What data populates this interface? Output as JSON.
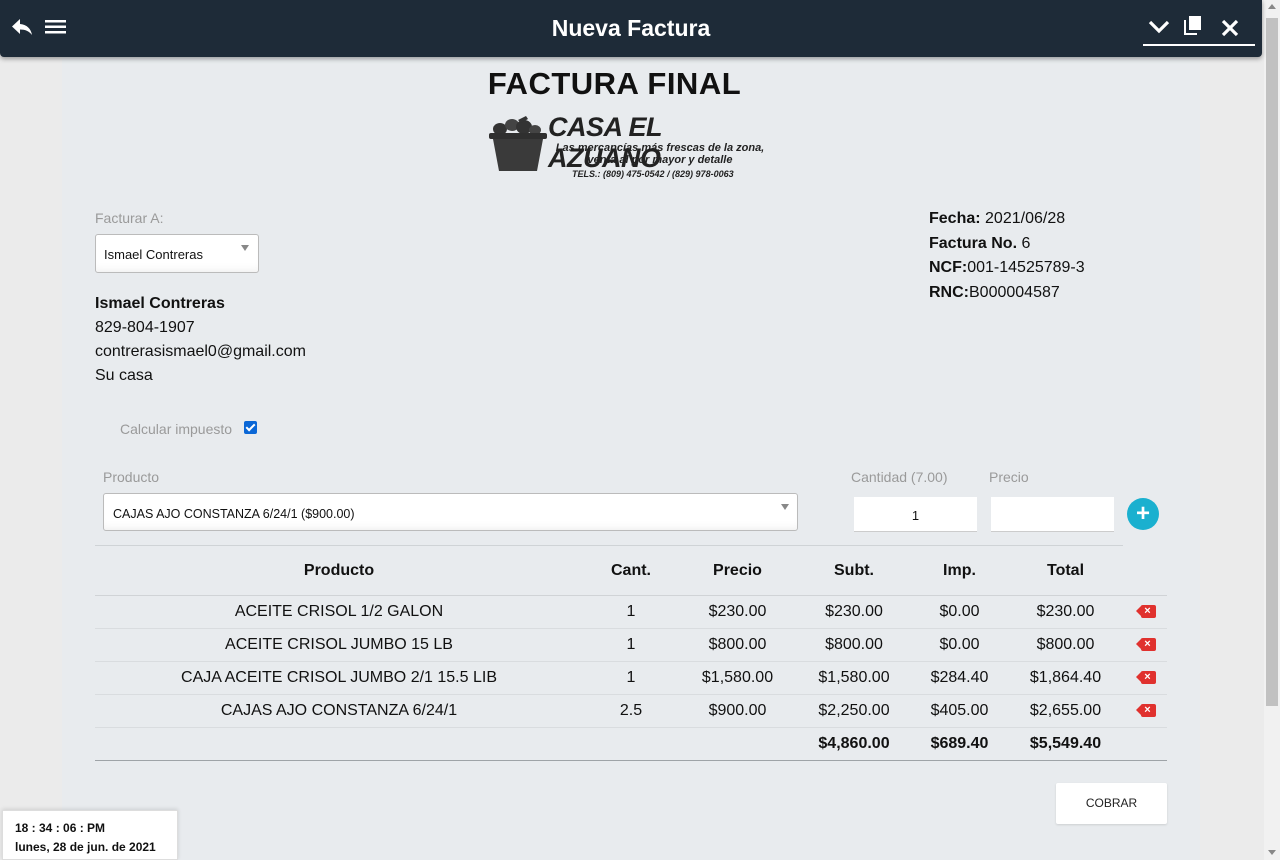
{
  "window": {
    "title": "Nueva Factura"
  },
  "icons": {
    "back": "back-arrow-icon",
    "menu": "menu-icon",
    "chevron": "chevron-down-icon",
    "copy": "copy-icon",
    "close": "close-icon",
    "add": "plus-icon",
    "delete": "delete-icon"
  },
  "invoice": {
    "heading": "FACTURA FINAL",
    "logo": {
      "brand": "CASA EL AZUANO",
      "tagline_1": "Las mercancías más frescas de la zona,",
      "tagline_2": "venta al por mayor y detalle",
      "phones": "TELS.: (809) 475-0542 / (829) 978-0063"
    },
    "bill_to_label": "Facturar A:",
    "client_select": "Ismael Contreras",
    "client": {
      "name": "Ismael Contreras",
      "phone": "829-804-1907",
      "email": "contrerasismael0@gmail.com",
      "address": "Su casa"
    },
    "meta": {
      "fecha_label": "Fecha:",
      "fecha": "2021/06/28",
      "factura_label": "Factura No.",
      "factura": "6",
      "ncf_label": "NCF:",
      "ncf": "001-14525789-3",
      "rnc_label": "RNC:",
      "rnc": "B000004587"
    },
    "tax_label": "Calcular impuesto",
    "tax_checked": true
  },
  "entry": {
    "product_label": "Producto",
    "product_value": "CAJAS AJO CONSTANZA 6/24/1 ($900.00)",
    "qty_label": "Cantidad (7.00)",
    "qty_value": "1",
    "price_label": "Precio",
    "price_value": "",
    "add_symbol": "+"
  },
  "table": {
    "headers": [
      "Producto",
      "Cant.",
      "Precio",
      "Subt.",
      "Imp.",
      "Total"
    ],
    "rows": [
      [
        "ACEITE CRISOL 1/2 GALON",
        "1",
        "$230.00",
        "$230.00",
        "$0.00",
        "$230.00"
      ],
      [
        "ACEITE CRISOL JUMBO 15 LB",
        "1",
        "$800.00",
        "$800.00",
        "$0.00",
        "$800.00"
      ],
      [
        "CAJA ACEITE CRISOL JUMBO 2/1 15.5 LIB",
        "1",
        "$1,580.00",
        "$1,580.00",
        "$284.40",
        "$1,864.40"
      ],
      [
        "CAJAS AJO CONSTANZA 6/24/1",
        "2.5",
        "$900.00",
        "$2,250.00",
        "$405.00",
        "$2,655.00"
      ]
    ],
    "totals": {
      "subtotal": "$4,860.00",
      "tax": "$689.40",
      "total": "$5,549.40"
    }
  },
  "actions": {
    "cobrar": "COBRAR"
  },
  "clock": {
    "time": "18 : 34 : 06 : PM",
    "date": "lunes, 28 de jun. de 2021"
  },
  "colors": {
    "titlebar": "#1e2b38",
    "accent": "#1ab0cf",
    "delete": "#e0312e",
    "checkbox": "#0b67d6"
  }
}
